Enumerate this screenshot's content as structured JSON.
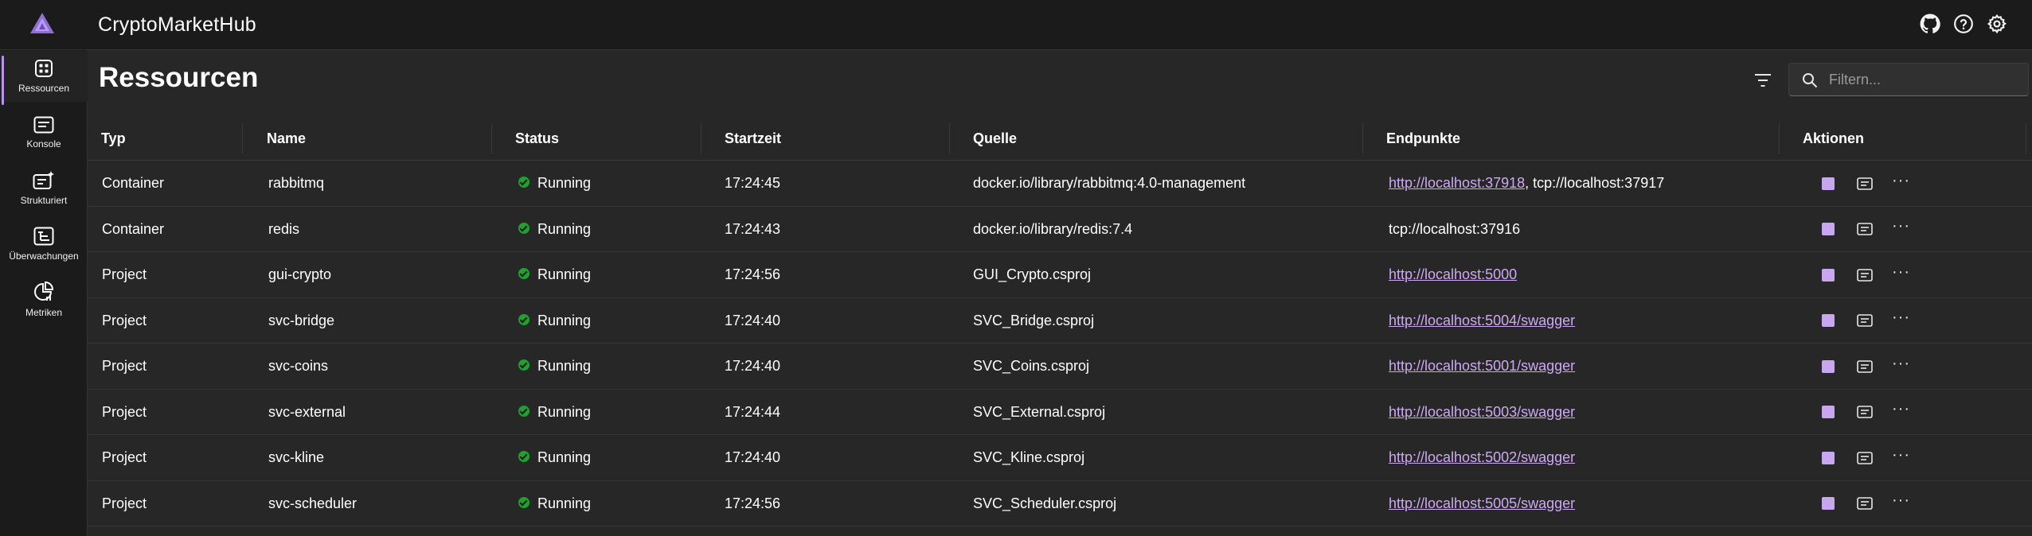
{
  "app": {
    "title": "CryptoMarketHub"
  },
  "sidebar": {
    "items": [
      {
        "label": "Ressourcen",
        "icon": "resources-icon",
        "active": true
      },
      {
        "label": "Konsole",
        "icon": "console-icon",
        "active": false
      },
      {
        "label": "Strukturiert",
        "icon": "structured-logs-icon",
        "active": false
      },
      {
        "label": "Überwachungen",
        "icon": "traces-icon",
        "active": false
      },
      {
        "label": "Metriken",
        "icon": "metrics-icon",
        "active": false
      }
    ]
  },
  "page": {
    "title": "Ressourcen",
    "search_placeholder": "Filtern..."
  },
  "table": {
    "columns": [
      "Typ",
      "Name",
      "Status",
      "Startzeit",
      "Quelle",
      "Endpunkte",
      "Aktionen"
    ],
    "rows": [
      {
        "type": "Container",
        "name": "rabbitmq",
        "status": "Running",
        "start": "17:24:45",
        "source": "docker.io/library/rabbitmq:4.0-management",
        "endpoint_link": "http://localhost:37918",
        "endpoint_extra": ", tcp://localhost:37917"
      },
      {
        "type": "Container",
        "name": "redis",
        "status": "Running",
        "start": "17:24:43",
        "source": "docker.io/library/redis:7.4",
        "endpoint_link": "",
        "endpoint_extra": "tcp://localhost:37916"
      },
      {
        "type": "Project",
        "name": "gui-crypto",
        "status": "Running",
        "start": "17:24:56",
        "source": "GUI_Crypto.csproj",
        "endpoint_link": "http://localhost:5000",
        "endpoint_extra": ""
      },
      {
        "type": "Project",
        "name": "svc-bridge",
        "status": "Running",
        "start": "17:24:40",
        "source": "SVC_Bridge.csproj",
        "endpoint_link": "http://localhost:5004/swagger",
        "endpoint_extra": ""
      },
      {
        "type": "Project",
        "name": "svc-coins",
        "status": "Running",
        "start": "17:24:40",
        "source": "SVC_Coins.csproj",
        "endpoint_link": "http://localhost:5001/swagger",
        "endpoint_extra": ""
      },
      {
        "type": "Project",
        "name": "svc-external",
        "status": "Running",
        "start": "17:24:44",
        "source": "SVC_External.csproj",
        "endpoint_link": "http://localhost:5003/swagger",
        "endpoint_extra": ""
      },
      {
        "type": "Project",
        "name": "svc-kline",
        "status": "Running",
        "start": "17:24:40",
        "source": "SVC_Kline.csproj",
        "endpoint_link": "http://localhost:5002/swagger",
        "endpoint_extra": ""
      },
      {
        "type": "Project",
        "name": "svc-scheduler",
        "status": "Running",
        "start": "17:24:56",
        "source": "SVC_Scheduler.csproj",
        "endpoint_link": "http://localhost:5005/swagger",
        "endpoint_extra": ""
      }
    ]
  },
  "colors": {
    "accent": "#c9a6f0",
    "link": "#cfa8f5",
    "status_running": "#1fa02f",
    "background": "#272727",
    "chrome": "#1b1b1b"
  }
}
